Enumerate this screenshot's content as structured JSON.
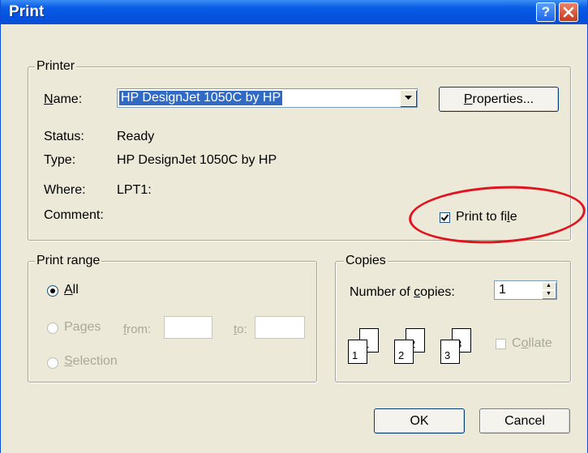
{
  "window": {
    "title": "Print",
    "help_icon": "question-mark",
    "close_icon": "x-mark"
  },
  "printer_group": {
    "legend": "Printer",
    "name_label": "Name:",
    "name_value": "HP DesignJet 1050C by HP",
    "properties_button": "Properties...",
    "status_label": "Status:",
    "status_value": "Ready",
    "type_label": "Type:",
    "type_value": "HP DesignJet 1050C by HP",
    "where_label": "Where:",
    "where_value": "LPT1:",
    "comment_label": "Comment:",
    "comment_value": "",
    "print_to_file_label": "Print to file",
    "print_to_file_checked": true
  },
  "print_range_group": {
    "legend": "Print range",
    "all_label": "All",
    "pages_label": "Pages",
    "from_label": "from:",
    "from_value": "",
    "to_label": "to:",
    "to_value": "",
    "selection_label": "Selection",
    "selected": "All"
  },
  "copies_group": {
    "legend": "Copies",
    "number_label": "Number of copies:",
    "number_value": "1",
    "collate_label": "Collate",
    "collate_checked": false,
    "stack1": [
      "1",
      "1"
    ],
    "stack2": [
      "2",
      "2"
    ],
    "stack3": [
      "3",
      "3"
    ]
  },
  "buttons": {
    "ok": "OK",
    "cancel": "Cancel"
  },
  "annotation": {
    "color": "#e0141f"
  }
}
